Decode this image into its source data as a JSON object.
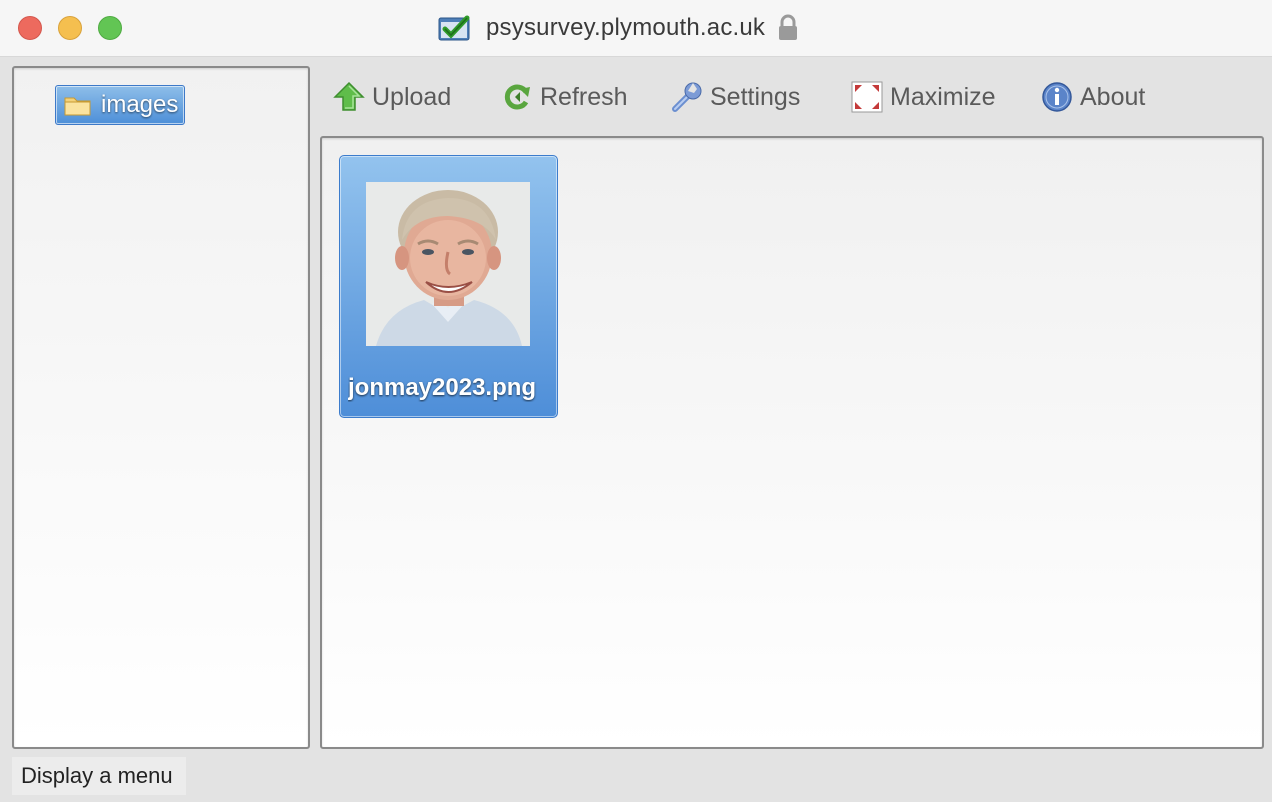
{
  "window": {
    "title": "psysurvey.plymouth.ac.uk",
    "title_icon": "checkbox-folder-icon",
    "secure_icon": "lock-icon"
  },
  "tree": {
    "items": [
      {
        "label": "images",
        "icon": "folder-icon",
        "selected": true
      }
    ]
  },
  "toolbar": {
    "upload_label": "Upload",
    "refresh_label": "Refresh",
    "settings_label": "Settings",
    "maximize_label": "Maximize",
    "about_label": "About"
  },
  "files": [
    {
      "name": "jonmay2023.png",
      "selected": true,
      "thumbnail": "portrait-photo"
    }
  ],
  "status": {
    "text": "Display a menu"
  },
  "colors": {
    "selection_top": "#93c3ee",
    "selection_bottom": "#4e8ed8",
    "selection_border": "#3c7ccc",
    "close": "#ed6a5e",
    "minimize": "#f5bf4f",
    "zoom": "#62c554"
  }
}
